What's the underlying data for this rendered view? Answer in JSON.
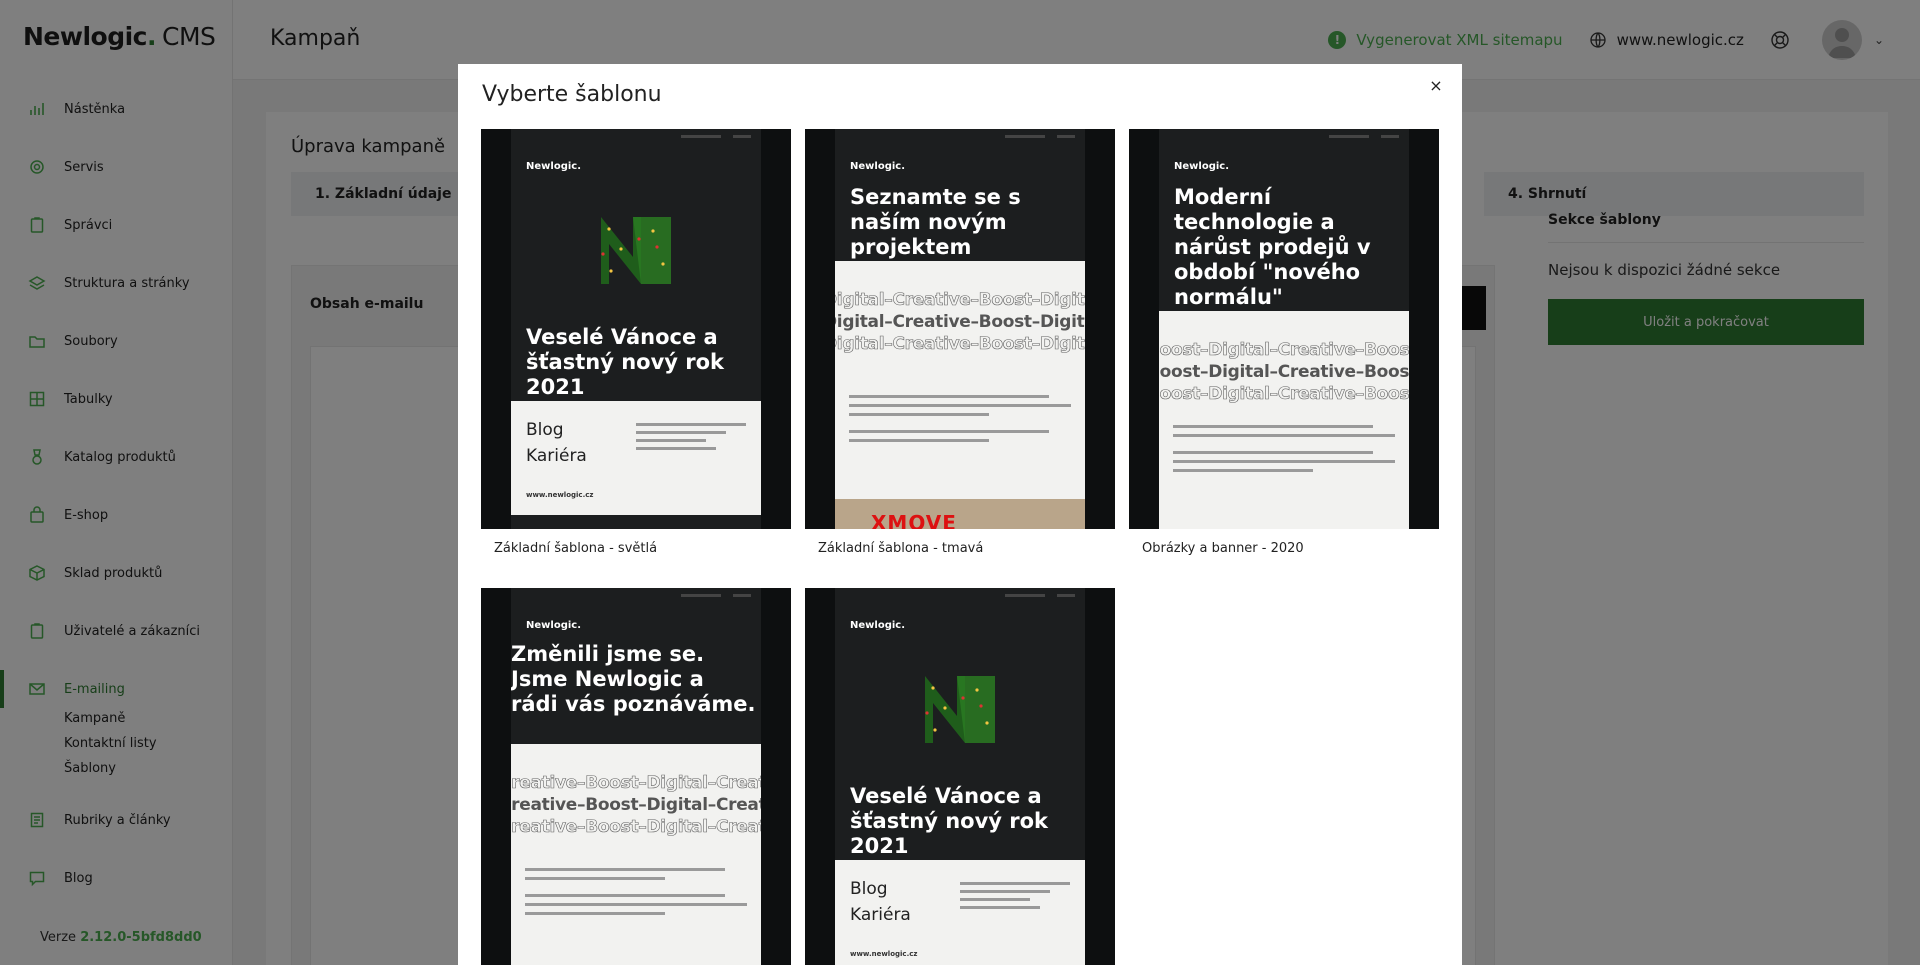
{
  "app": {
    "logo_main": "Newlogic",
    "logo_dot": ".",
    "logo_suffix": "CMS"
  },
  "header": {
    "title": "Kampaň",
    "sitemap_label": "Vygenerovat XML sitemapu",
    "domain": "www.newlogic.cz"
  },
  "sidebar": {
    "items": [
      {
        "label": "Nástěnka",
        "icon": "chart-bars-icon"
      },
      {
        "label": "Servis",
        "icon": "gear-icon"
      },
      {
        "label": "Správci",
        "icon": "clipboard-icon"
      },
      {
        "label": "Struktura a stránky",
        "icon": "layers-icon"
      },
      {
        "label": "Soubory",
        "icon": "folder-icon"
      },
      {
        "label": "Tabulky",
        "icon": "table-icon"
      },
      {
        "label": "Katalog produktů",
        "icon": "tag-icon"
      },
      {
        "label": "E-shop",
        "icon": "shopping-bag-icon"
      },
      {
        "label": "Sklad produktů",
        "icon": "box-icon"
      },
      {
        "label": "Uživatelé a zákazníci",
        "icon": "clipboard-user-icon"
      },
      {
        "label": "E-mailing",
        "icon": "mail-icon"
      },
      {
        "label": "Rubriky a články",
        "icon": "document-icon"
      },
      {
        "label": "Blog",
        "icon": "chat-icon"
      }
    ],
    "emailing_sub": [
      "Kampaně",
      "Kontaktní listy",
      "Šablony"
    ],
    "version_label": "Verze",
    "version_value": "2.12.0-5bfd8dd0"
  },
  "main": {
    "card_title": "Úprava kampaně",
    "steps": [
      "1. Základní údaje",
      "4. Shrnutí"
    ],
    "content_label": "Obsah e-mailu",
    "sections_title": "Sekce šablony",
    "sections_empty": "Nejsou k dispozici žádné sekce",
    "save_button": "Uložit a pokračovat"
  },
  "modal": {
    "title": "Vyberte šablonu",
    "close": "×",
    "templates": [
      {
        "name": "Základní šablona - světlá",
        "preview": {
          "brand": "Newlogic.",
          "headline": "Veselé Vánoce a šťastný nový rok 2021",
          "blog": "Blog",
          "career": "Kariéra",
          "url": "www.newlogic.cz"
        }
      },
      {
        "name": "Základní šablona - tmavá",
        "preview": {
          "brand": "Newlogic.",
          "headline": "Seznamte se s naším novým projektem",
          "strip": "Digital–Creative–Boost–Digital–Creative–Boost–",
          "logo_text": "XMOVE"
        }
      },
      {
        "name": "Obrázky a banner - 2020",
        "preview": {
          "brand": "Newlogic.",
          "headline": "Moderní technologie a nárůst prodejů v období \"nového normálu\"",
          "strip": "Boost–Digital–Creative–Boost–Digital–Creative–"
        }
      },
      {
        "name": "",
        "preview": {
          "brand": "Newlogic.",
          "headline": "Změnili jsme se. Jsme Newlogic a rádi vás poznáváme.",
          "strip": "Creative–Boost–Digital–Creative–Boost–Digital–"
        }
      },
      {
        "name": "",
        "preview": {
          "brand": "Newlogic.",
          "headline": "Veselé Vánoce a šťastný nový rok 2021",
          "blog": "Blog",
          "career": "Kariéra",
          "url": "www.newlogic.cz"
        }
      }
    ]
  },
  "colors": {
    "accent": "#4caf50",
    "accent_dark": "#2f7d32",
    "overlay": "rgba(0,0,0,0.5)"
  }
}
